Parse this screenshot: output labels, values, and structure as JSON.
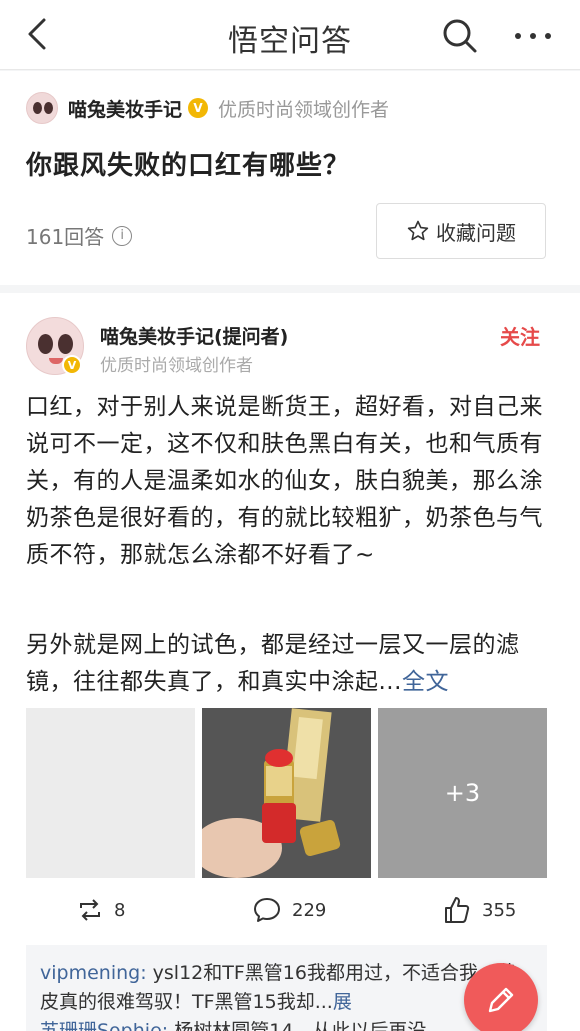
{
  "header": {
    "title": "悟空问答",
    "back_icon": "back-chevron-icon",
    "search_icon": "search-icon",
    "more_icon": "more-dots-icon"
  },
  "question": {
    "author_name": "喵兔美妆手记",
    "author_badge": "V",
    "author_desc": "优质时尚领域创作者",
    "title": "你跟风失败的口红有哪些？",
    "answer_count": "161回答",
    "info_glyph": "i",
    "collect_label": "收藏问题"
  },
  "answer": {
    "author_name": "喵兔美妆手记(提问者)",
    "author_badge": "V",
    "author_desc": "优质时尚领域创作者",
    "follow_label": "关注",
    "paragraph1": "口红，对于别人来说是断货王，超好看，对自己来说可不一定，这不仅和肤色黑白有关，也和气质有关，有的人是温柔如水的仙女，肤白貌美，那么涂奶茶色是很好看的，有的就比较粗犷，奶茶色与气质不符，那就怎么涂都不好看了~",
    "paragraph2": "另外就是网上的试色，都是经过一层又一层的滤镜，往往都失真了，和真实中涂起...",
    "fulltext_label": "全文",
    "more_images": "+3",
    "repost_count": "8",
    "comment_count": "229",
    "like_count": "355"
  },
  "comments": [
    {
      "user": "vipmening:",
      "text": " ysl12和TF黑管16我都用过，不适合我，黄皮真的很难驾驭！TF黑管15我却...",
      "more": "展"
    },
    {
      "user": "苏珊珊Sophie:",
      "text": " 杨树林圆管14，从此以后再没",
      "more": ""
    }
  ],
  "colors": {
    "accent_red": "#e64a4a",
    "link_blue": "#406599",
    "fab_red": "#f05a5a",
    "badge_yellow": "#f2b705"
  }
}
